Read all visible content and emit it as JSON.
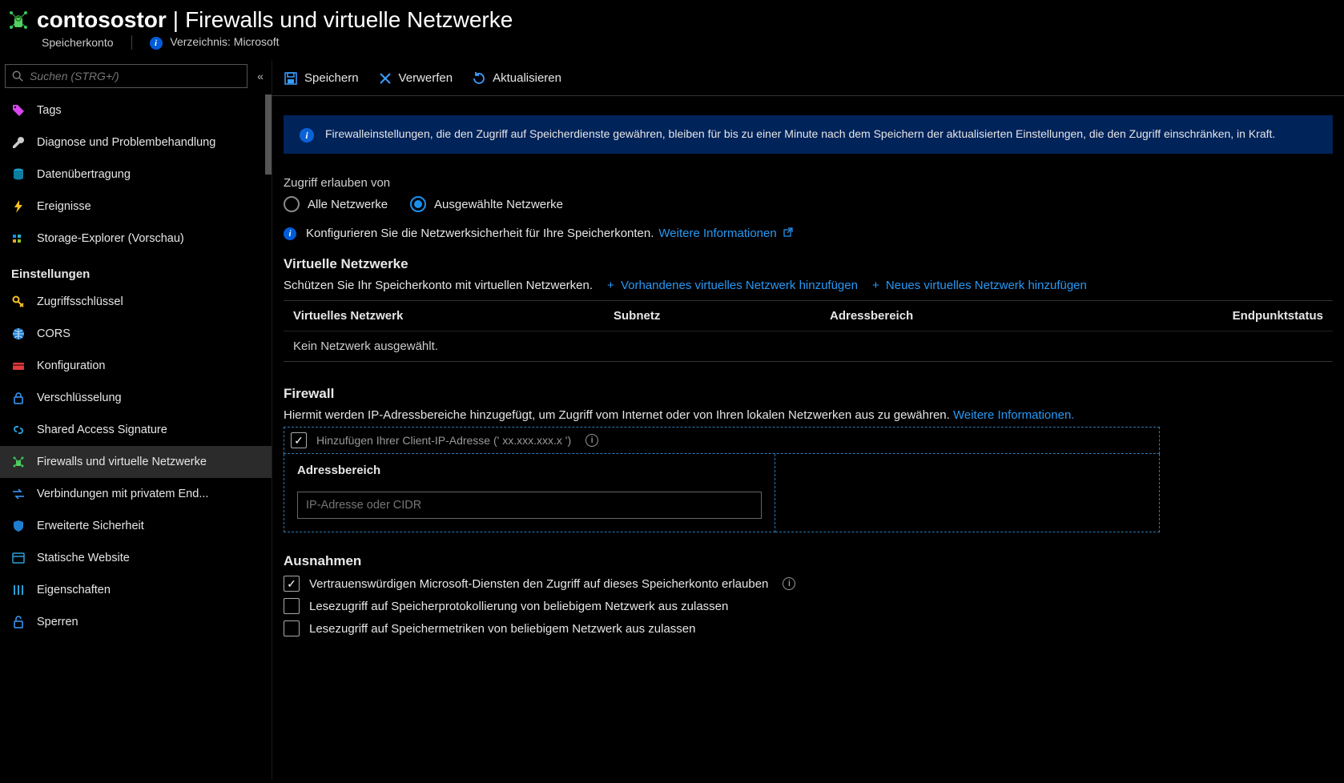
{
  "header": {
    "resource_name": "contosostor",
    "page_title": "Firewalls und virtuelle Netzwerke",
    "resource_type": "Speicherkonto",
    "directory_label": "Verzeichnis: Microsoft"
  },
  "search": {
    "placeholder": "Suchen (STRG+/)"
  },
  "sidebar": {
    "items_top": [
      {
        "label": "Tags",
        "icon": "tag"
      },
      {
        "label": "Diagnose und Problembehandlung",
        "icon": "wrench"
      },
      {
        "label": "Datenübertragung",
        "icon": "cylinder"
      },
      {
        "label": "Ereignisse",
        "icon": "bolt"
      },
      {
        "label": "Storage-Explorer (Vorschau)",
        "icon": "grid"
      }
    ],
    "section_label": "Einstellungen",
    "items_settings": [
      {
        "label": "Zugriffsschlüssel",
        "icon": "key"
      },
      {
        "label": "CORS",
        "icon": "globe"
      },
      {
        "label": "Konfiguration",
        "icon": "card"
      },
      {
        "label": "Verschlüsselung",
        "icon": "lock"
      },
      {
        "label": "Shared Access Signature",
        "icon": "link"
      },
      {
        "label": "Firewalls und virtuelle Netzwerke",
        "icon": "network",
        "active": true
      },
      {
        "label": "Verbindungen mit privatem End...",
        "icon": "arrows"
      },
      {
        "label": "Erweiterte Sicherheit",
        "icon": "shield"
      },
      {
        "label": "Statische Website",
        "icon": "window"
      },
      {
        "label": "Eigenschaften",
        "icon": "bars"
      },
      {
        "label": "Sperren",
        "icon": "lockopen"
      }
    ]
  },
  "commands": {
    "save": "Speichern",
    "discard": "Verwerfen",
    "refresh": "Aktualisieren"
  },
  "notice": "Firewalleinstellungen, die den Zugriff auf Speicherdienste gewähren, bleiben für bis zu einer Minute nach dem Speichern der aktualisierten Einstellungen, die den Zugriff einschränken, in Kraft.",
  "access": {
    "label": "Zugriff erlauben von",
    "all": "Alle Netzwerke",
    "selected": "Ausgewählte Netzwerke"
  },
  "config_hint": "Konfigurieren Sie die Netzwerksicherheit für Ihre Speicherkonten.",
  "more_info": "Weitere Informationen",
  "more_info_period": "Weitere Informationen.",
  "vnet": {
    "heading": "Virtuelle Netzwerke",
    "desc": "Schützen Sie Ihr Speicherkonto mit virtuellen Netzwerken.",
    "add_existing": "Vorhandenes virtuelles Netzwerk hinzufügen",
    "add_new": "Neues virtuelles Netzwerk hinzufügen",
    "col1": "Virtuelles Netzwerk",
    "col2": "Subnetz",
    "col3": "Adressbereich",
    "col4": "Endpunktstatus",
    "empty": "Kein Netzwerk ausgewählt."
  },
  "firewall": {
    "heading": "Firewall",
    "desc": "Hiermit werden IP-Adressbereiche hinzugefügt, um Zugriff vom Internet oder von Ihren lokalen Netzwerken aus zu gewähren.",
    "add_client": "Hinzufügen Ihrer Client-IP-Adresse (' xx.xxx.xxx.x ')",
    "addr_head": "Adressbereich",
    "addr_placeholder": "IP-Adresse oder CIDR"
  },
  "exceptions": {
    "heading": "Ausnahmen",
    "items": [
      {
        "label": "Vertrauenswürdigen Microsoft-Diensten den Zugriff auf dieses Speicherkonto erlauben",
        "checked": true,
        "info": true
      },
      {
        "label": "Lesezugriff auf Speicherprotokollierung von beliebigem Netzwerk aus zulassen",
        "checked": false
      },
      {
        "label": "Lesezugriff auf Speichermetriken von beliebigem Netzwerk aus zulassen",
        "checked": false
      }
    ]
  }
}
